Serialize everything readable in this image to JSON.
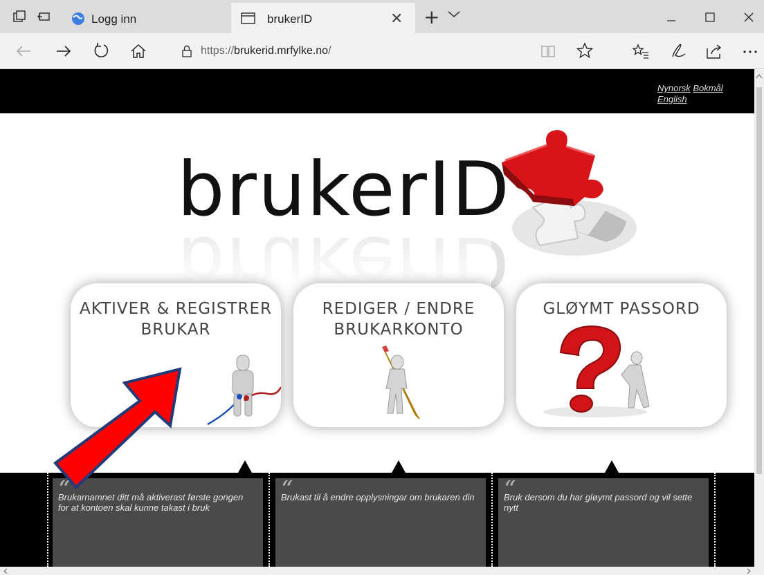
{
  "browser": {
    "tabs": [
      {
        "label": "Logg inn",
        "icon": "globe-icon",
        "active": false
      },
      {
        "label": "brukerID",
        "icon": "page-icon",
        "active": true
      }
    ],
    "url_prefix": "https://",
    "url_host": "brukerid.mrfylke.no",
    "url_suffix": "/"
  },
  "page": {
    "languages": [
      "Nynorsk",
      "Bokmål",
      "English"
    ],
    "logo_text": "brukerID",
    "cards": [
      {
        "title_line1": "AKTIVER & REGISTRER",
        "title_line2": "BRUKAR",
        "description": "Brukarnamnet ditt må aktiverast første gongen for at kontoen skal kunne takast i bruk"
      },
      {
        "title_line1": "REDIGER / ENDRE",
        "title_line2": "BRUKARKONTO",
        "description": "Brukast til å endre opplysningar om brukaren din"
      },
      {
        "title_line1": "GLØYMT PASSORD",
        "title_line2": "",
        "description": "Bruk dersom du har gløymt passord og vil sette nytt"
      }
    ]
  },
  "colors": {
    "annotation_arrow": "#ff0000",
    "puzzle": "#d81418",
    "band": "#000000",
    "info_box": "#4a4a4a"
  }
}
